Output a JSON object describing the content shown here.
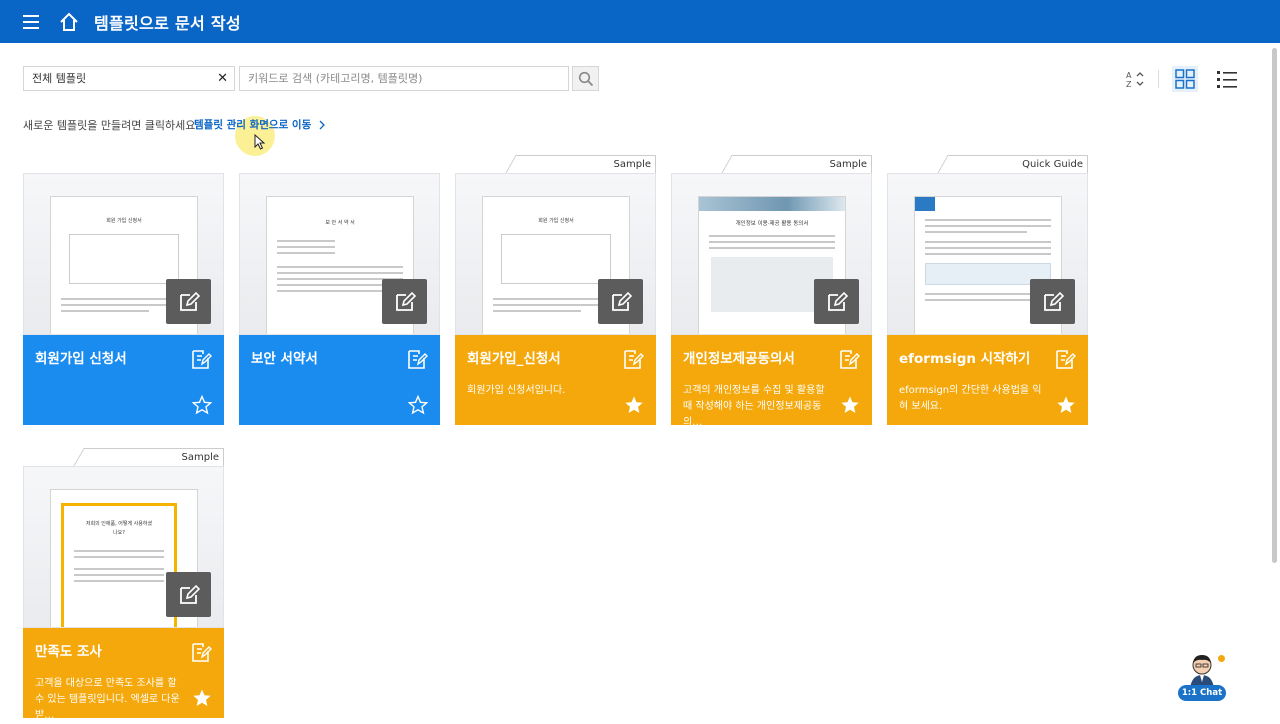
{
  "header": {
    "title": "템플릿으로 문서 작성"
  },
  "filter": {
    "value": "전체 템플릿",
    "clear": "✕"
  },
  "search": {
    "placeholder": "키워드로 검색 (카테고리명, 템플릿명)"
  },
  "hint": {
    "text": "새로운 템플릿을 만들려면 클릭하세요.",
    "link": "템플릿 관리 화면으로 이동"
  },
  "sort": {
    "label": "A Z"
  },
  "cards": [
    {
      "name": "회원가입 신청서",
      "desc": "",
      "tab": "",
      "color": "#1a8cf0",
      "starred": false,
      "paper_title": "회원 가입 신청서"
    },
    {
      "name": "보안 서약서",
      "desc": "",
      "tab": "",
      "color": "#1a8cf0",
      "starred": false,
      "paper_title": "보 안 서 약 서"
    },
    {
      "name": "회원가입_신청서",
      "desc": "회원가입 신청서입니다.",
      "tab": "Sample",
      "color": "#f4a80c",
      "starred": true,
      "paper_title": "회원 가입 신청서"
    },
    {
      "name": "개인정보제공동의서",
      "desc": "고객의 개인정보를 수집 및 활용할 때 작성해야 하는 개인정보제공동의…",
      "tab": "Sample",
      "color": "#f4a80c",
      "starred": true,
      "paper_title": "개인정보 이용·제공 활용 동의서"
    },
    {
      "name": "eformsign 시작하기",
      "desc": "eformsign의 간단한 사용법을 익혀 보세요.",
      "tab": "Quick Guide",
      "color": "#f4a80c",
      "starred": true,
      "paper_title": ""
    },
    {
      "name": "만족도 조사",
      "desc": "고객을 대상으로 만족도 조사를 할 수 있는 템플릿입니다. 엑셀로 다운받…",
      "tab": "Sample",
      "color": "#f4a80c",
      "starred": true,
      "paper_title": "저희의 인애품, 어떻게 사용하셨나요?"
    }
  ],
  "chat": {
    "label": "1:1 Chat"
  }
}
